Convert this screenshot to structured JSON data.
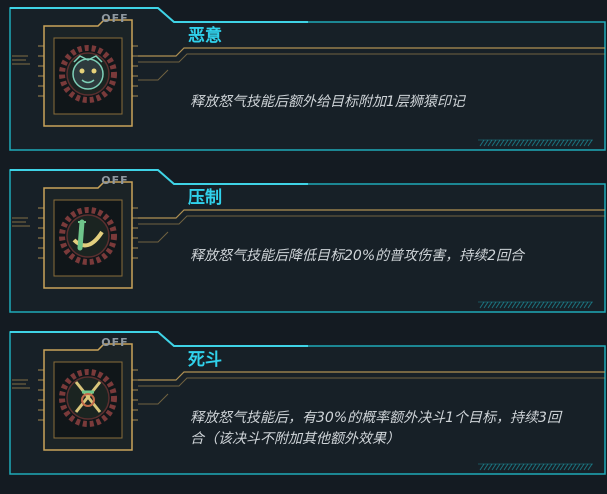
{
  "skills": [
    {
      "status": "OFF",
      "name": "恶意",
      "description": "释放怒气技能后额外给目标附加1层狮猿印记",
      "icon": "monkey-face-icon"
    },
    {
      "status": "OFF",
      "name": "压制",
      "description": "释放怒气技能后降低目标20%的普攻伤害，持续2回合",
      "icon": "crossed-blades-icon"
    },
    {
      "status": "OFF",
      "name": "死斗",
      "description": "释放怒气技能后，有30%的概率额外决斗1个目标，持续3回合（该决斗不附加其他额外效果）",
      "icon": "dueling-swords-icon"
    }
  ],
  "colors": {
    "accent": "#30d2ec",
    "frame": "#1fa9b8",
    "gold": "#c9a35a",
    "panel": "#172027"
  }
}
